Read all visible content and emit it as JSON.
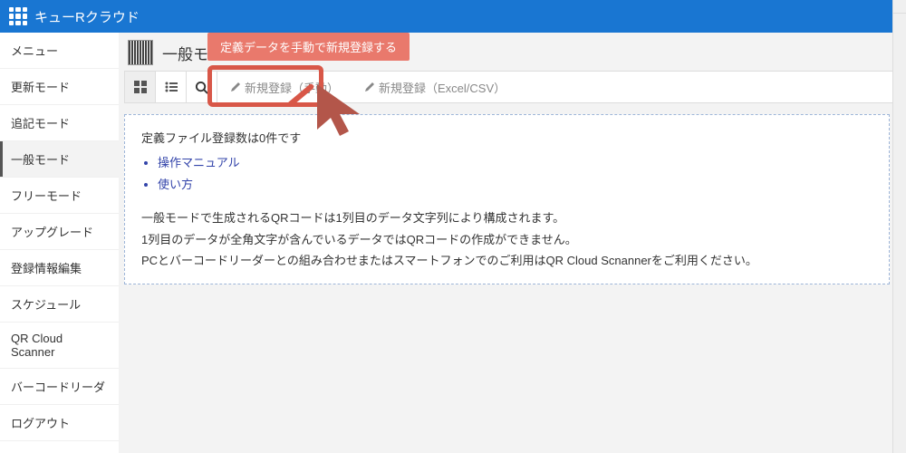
{
  "header": {
    "title": "キューRクラウド"
  },
  "sidebar": {
    "items": [
      "メニュー",
      "更新モード",
      "追記モード",
      "一般モード",
      "フリーモード",
      "アップグレード",
      "登録情報編集",
      "スケジュール",
      "QR Cloud Scanner",
      "バーコードリーダ",
      "ログアウト"
    ],
    "active_index": 3
  },
  "breadcrumb": {
    "title": "一般モ"
  },
  "toolbar": {
    "new_manual": "新規登録（手動）",
    "new_csv": "新規登録（Excel/CSV）"
  },
  "tooltip": {
    "text": "定義データを手動で新規登録する"
  },
  "info": {
    "count_text": "定義ファイル登録数は0件です",
    "links": [
      "操作マニュアル",
      "使い方"
    ],
    "body1": "一般モードで生成されるQRコードは1列目のデータ文字列により構成されます。",
    "body2": "1列目のデータが全角文字が含んでいるデータではQRコードの作成ができません。",
    "body3": "PCとバーコードリーダーとの組み合わせまたはスマートフォンでのご利用はQR Cloud Scnannerをご利用ください。"
  },
  "colors": {
    "accent": "#1976d2",
    "callout": "#d85748",
    "tooltip_bg": "#e9796c"
  }
}
